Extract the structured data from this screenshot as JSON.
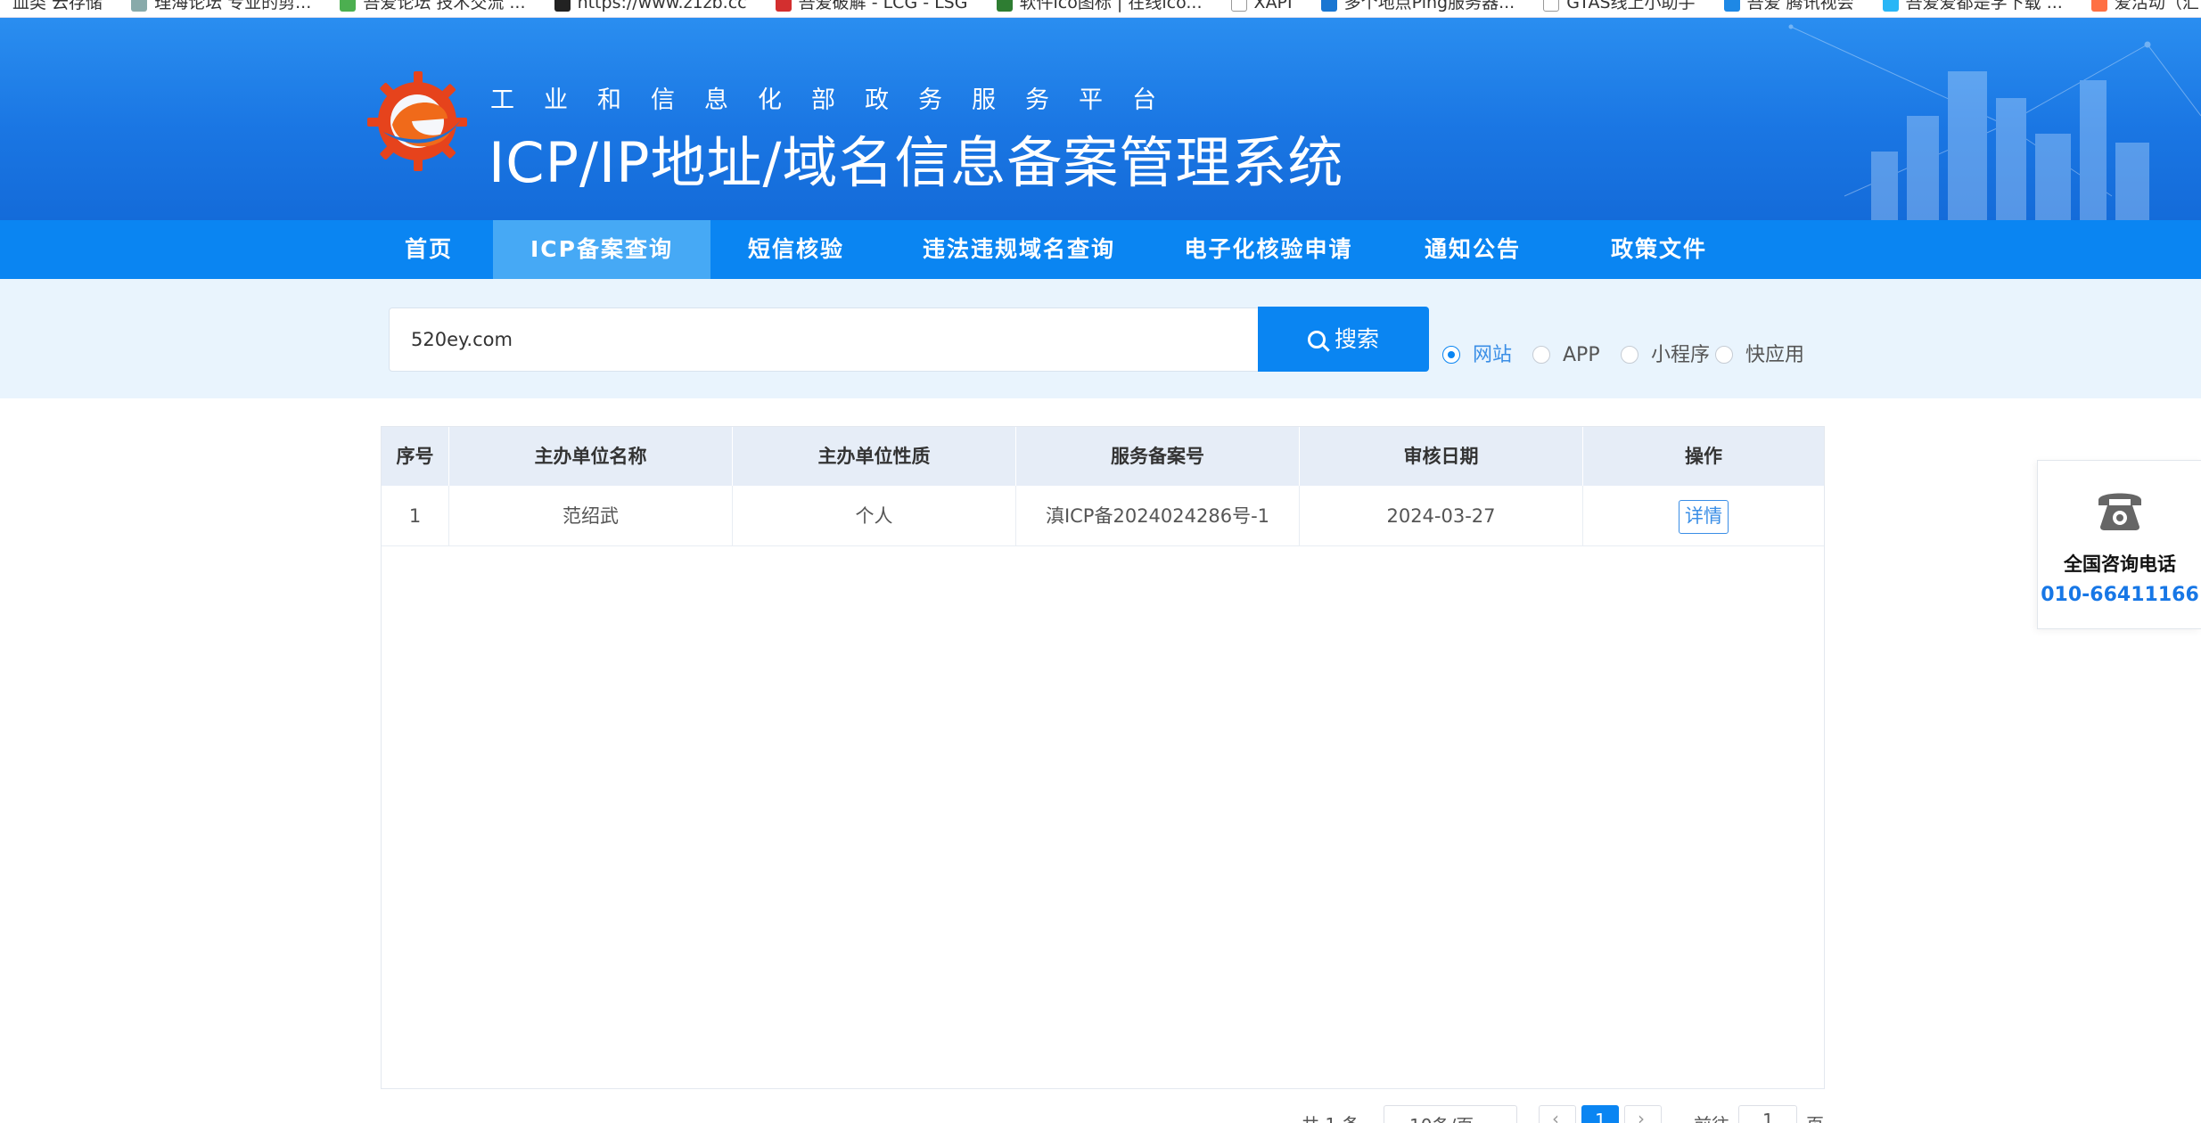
{
  "bookmarks": [
    "血类 云存储",
    "理海论坛 专业的剪...",
    "吾爱论坛 技术交流 ...",
    "https://www.z1zb.cc",
    "吾爱破解 - LCG - LSG",
    "软件ico图标 | 在线ico...",
    "XAPI",
    "多个地点Ping服务器...",
    "GTAS线上小助手",
    "吾爱 腾讯视会",
    "吾爱爱都是学下载 ...",
    "爱活动（汇世大副）"
  ],
  "header": {
    "subtitle": "工业和信息化部政务服务平台",
    "title": "ICP/IP地址/域名信息备案管理系统"
  },
  "nav": {
    "items": [
      {
        "label": "首页"
      },
      {
        "label": "ICP备案查询"
      },
      {
        "label": "短信核验"
      },
      {
        "label": "违法违规域名查询"
      },
      {
        "label": "电子化核验申请"
      },
      {
        "label": "通知公告"
      },
      {
        "label": "政策文件"
      }
    ],
    "active_index": 1
  },
  "search": {
    "value": "520ey.com",
    "button_label": "搜索",
    "options": [
      {
        "label": "网站",
        "checked": true
      },
      {
        "label": "APP",
        "checked": false
      },
      {
        "label": "小程序",
        "checked": false
      },
      {
        "label": "快应用",
        "checked": false
      }
    ]
  },
  "table": {
    "columns": [
      "序号",
      "主办单位名称",
      "主办单位性质",
      "服务备案号",
      "审核日期",
      "操作"
    ],
    "rows": [
      {
        "index": "1",
        "org_name": "范绍武",
        "org_type": "个人",
        "license": "滇ICP备2024024286号-1",
        "date": "2024-03-27",
        "action": "详情"
      }
    ]
  },
  "pagination": {
    "total": "共 1 条",
    "page_size": "10条/页",
    "current_page": "1",
    "goto_label": "前往",
    "goto_value": "1",
    "page_unit": "页"
  },
  "contact": {
    "icon": "phone-icon",
    "label": "全国咨询电话",
    "number": "010-66411166"
  },
  "colors": {
    "primary": "#0a85f2",
    "nav_active": "#46a9f5",
    "search_bg": "#e9f4fd",
    "table_header": "#e6edf7",
    "link": "#3a8ee6"
  }
}
